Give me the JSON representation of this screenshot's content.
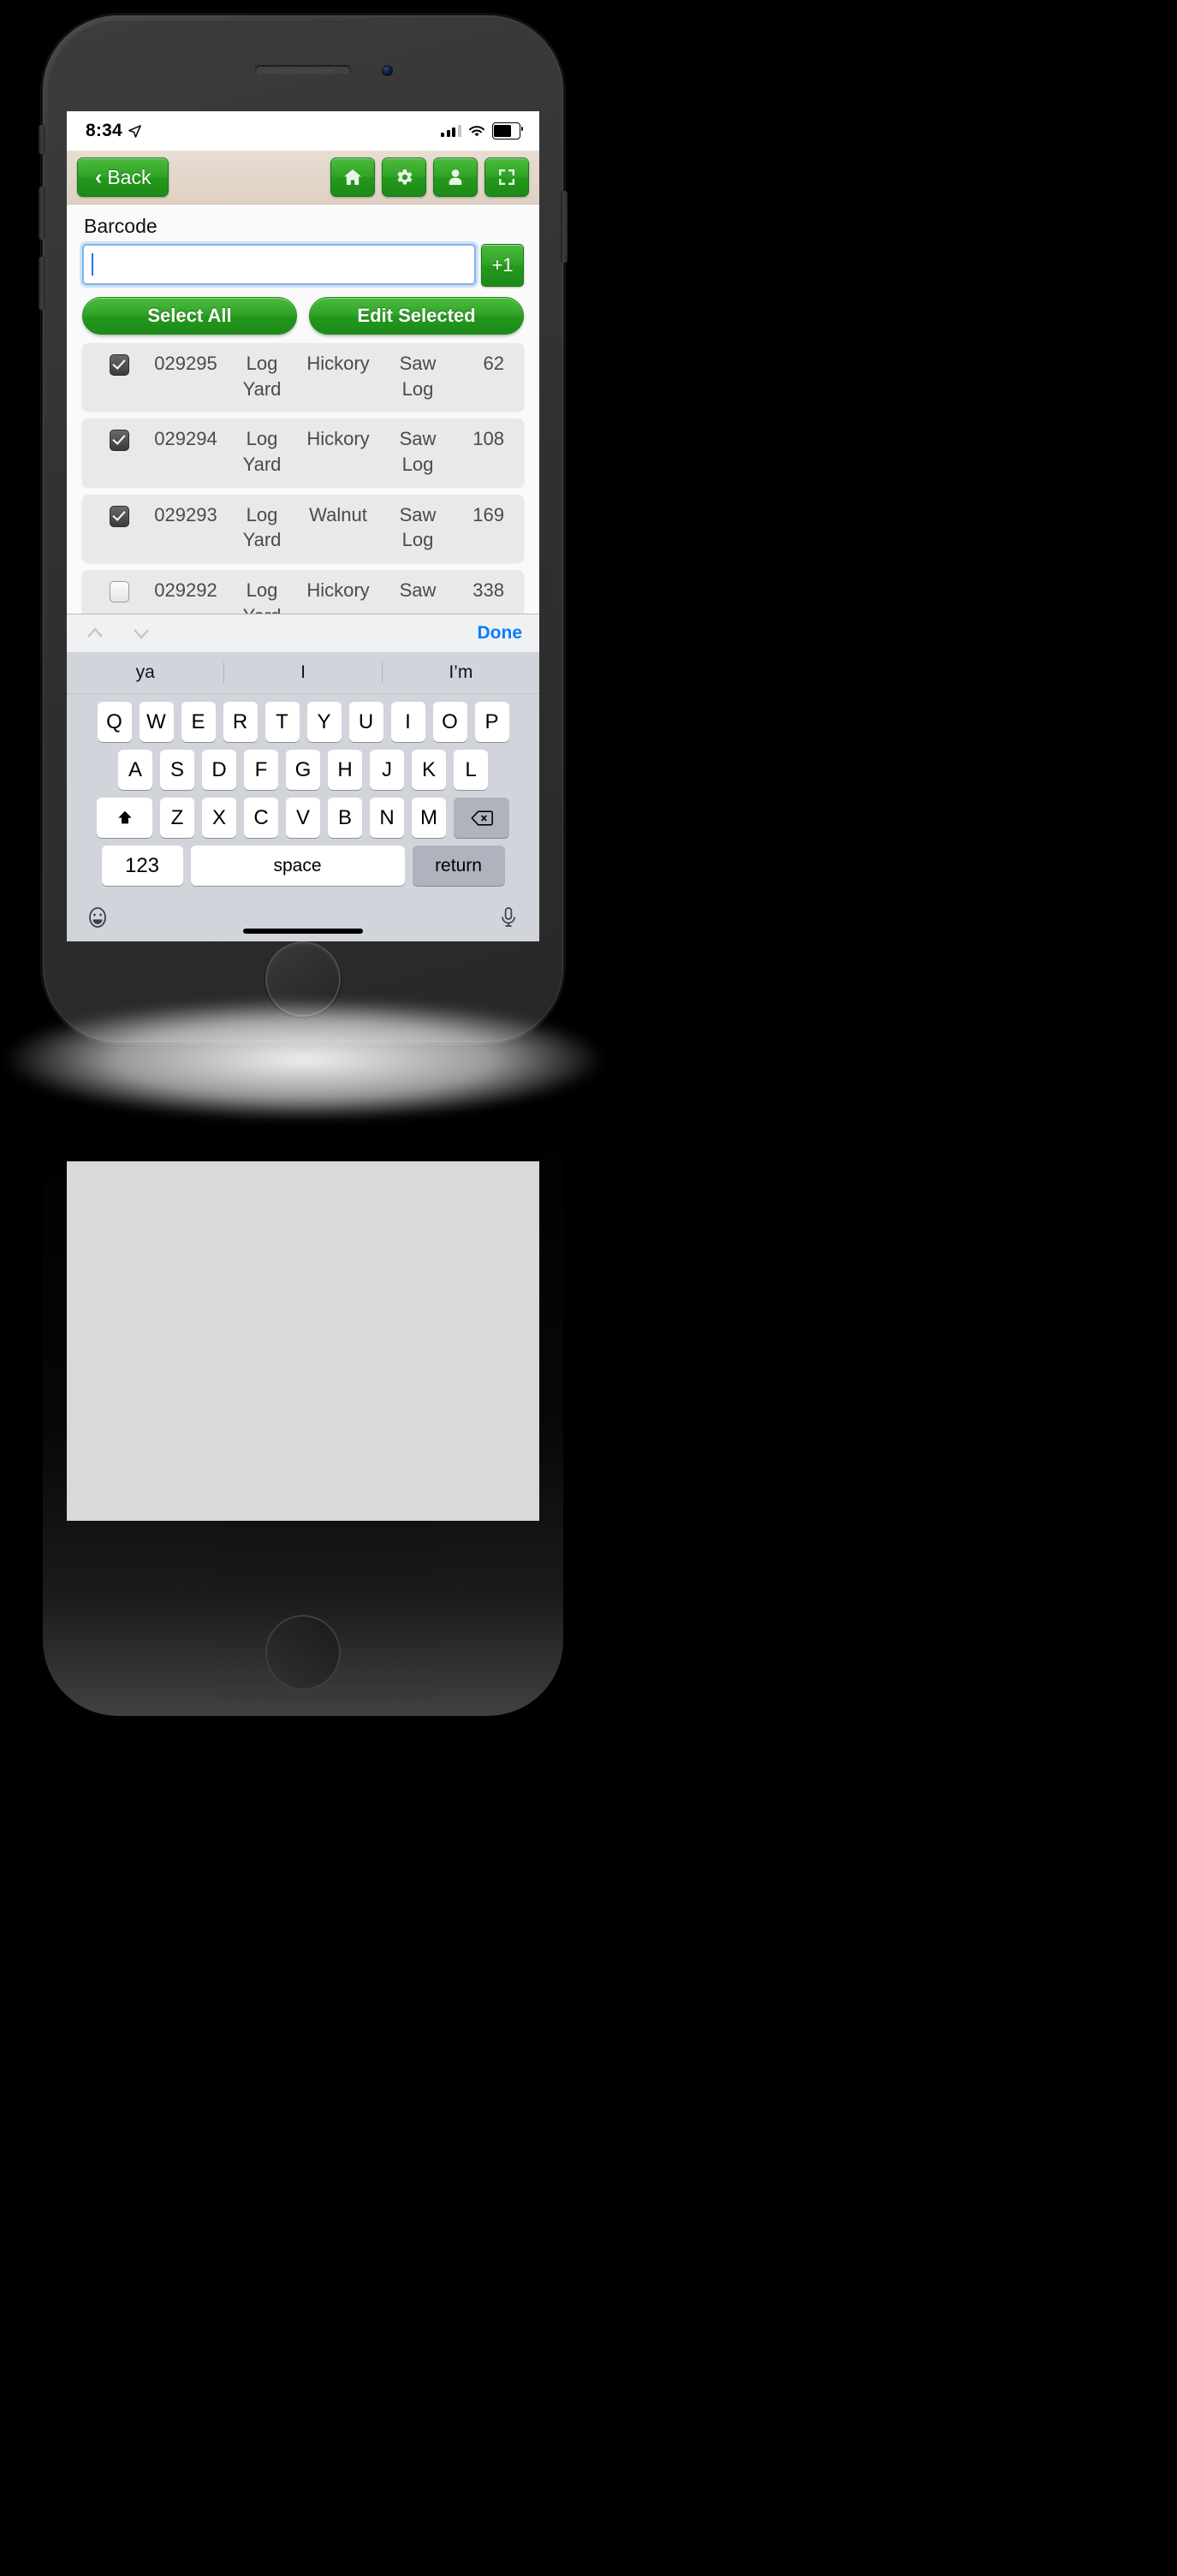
{
  "status_bar": {
    "time": "8:34",
    "location_icon": "location-arrow-icon",
    "signal_icon": "cellular-signal-icon",
    "wifi_icon": "wifi-icon",
    "battery_icon": "battery-icon"
  },
  "toolbar": {
    "back_label": "Back",
    "back_chevron": "‹",
    "buttons": [
      {
        "name": "home-button",
        "icon": "home-icon"
      },
      {
        "name": "settings-button",
        "icon": "gear-icon"
      },
      {
        "name": "user-button",
        "icon": "person-icon"
      },
      {
        "name": "fullscreen-button",
        "icon": "expand-icon"
      }
    ]
  },
  "form": {
    "barcode_label": "Barcode",
    "barcode_value": "",
    "barcode_placeholder": "",
    "plus_one_label": "+1"
  },
  "actions": {
    "select_all": "Select All",
    "edit_selected": "Edit Selected"
  },
  "list": {
    "rows": [
      {
        "checked": true,
        "id": "029295",
        "location": "Log Yard",
        "species": "Hickory",
        "product": "Saw Log",
        "qty": "62"
      },
      {
        "checked": true,
        "id": "029294",
        "location": "Log Yard",
        "species": "Hickory",
        "product": "Saw Log",
        "qty": "108"
      },
      {
        "checked": true,
        "id": "029293",
        "location": "Log Yard",
        "species": "Walnut",
        "product": "Saw Log",
        "qty": "169"
      },
      {
        "checked": false,
        "id": "029292",
        "location": "Log Yard",
        "species": "Hickory",
        "product": "Saw",
        "qty": "338"
      }
    ]
  },
  "keyboard": {
    "accessory": {
      "prev_icon": "chevron-up-icon",
      "next_icon": "chevron-down-icon",
      "done_label": "Done"
    },
    "predictions": [
      "ya",
      "I",
      "I’m"
    ],
    "row1": [
      "Q",
      "W",
      "E",
      "R",
      "T",
      "Y",
      "U",
      "I",
      "O",
      "P"
    ],
    "row2": [
      "A",
      "S",
      "D",
      "F",
      "G",
      "H",
      "J",
      "K",
      "L"
    ],
    "row3": [
      "Z",
      "X",
      "C",
      "V",
      "B",
      "N",
      "M"
    ],
    "shift_icon": "shift-arrow-icon",
    "backspace_icon": "backspace-icon",
    "numbers_label": "123",
    "space_label": "space",
    "return_label": "return",
    "emoji_icon": "emoji-smiley-icon",
    "mic_icon": "microphone-icon"
  },
  "colors": {
    "accent_green": "#2fa327",
    "toolbar_bg": "#ded1c3",
    "link_blue": "#0a7cff",
    "focus_blue": "#7fb3e8"
  }
}
